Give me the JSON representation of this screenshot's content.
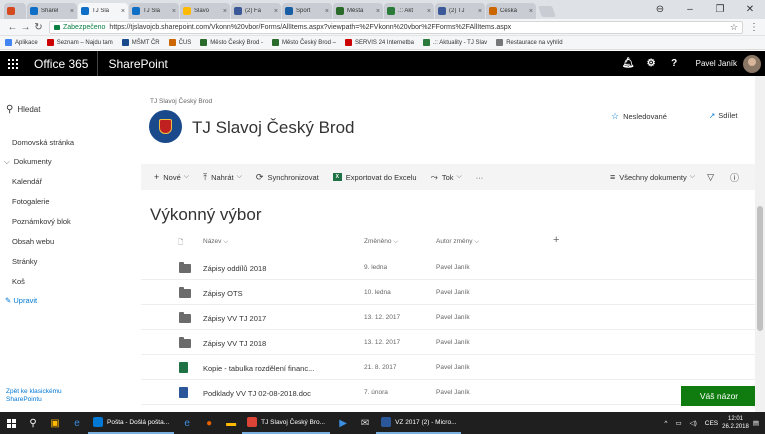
{
  "browser": {
    "tabs": [
      {
        "label": "",
        "color": "#d44a1e",
        "active": false
      },
      {
        "label": "Sharel",
        "color": "#0f6fc6",
        "active": false
      },
      {
        "label": "TJ Sla",
        "color": "#0f6fc6",
        "active": true
      },
      {
        "label": "TJ Sla",
        "color": "#0f6fc6",
        "active": false
      },
      {
        "label": "Slavo",
        "color": "#ffb900",
        "active": false
      },
      {
        "label": "(2) Fa",
        "color": "#3b5998",
        "active": false
      },
      {
        "label": "Sport",
        "color": "#1a5fa6",
        "active": false
      },
      {
        "label": "Města",
        "color": "#2a6a2a",
        "active": false
      },
      {
        "label": ".:: Akt",
        "color": "#2a7a3a",
        "active": false
      },
      {
        "label": "(2) TJ",
        "color": "#3b5998",
        "active": false
      },
      {
        "label": "Česká",
        "color": "#cc6600",
        "active": false
      }
    ],
    "secure_label": "Zabezpečeno",
    "url": "https://tjslavojcb.sharepoint.com/Vkonn%20vbor/Forms/AllItems.aspx?viewpath=%2FVkonn%20vbor%2FForms%2FAllItems.aspx",
    "bookmarks": [
      {
        "label": "Aplikace",
        "color": "#4285f4"
      },
      {
        "label": "Seznam – Najdu tam",
        "color": "#cc0000"
      },
      {
        "label": "MŠMT ČR",
        "color": "#1a4a8c"
      },
      {
        "label": "ČUS",
        "color": "#cc6600"
      },
      {
        "label": "Město Český Brod -",
        "color": "#2a6a2a"
      },
      {
        "label": "Město Český Brod –",
        "color": "#2a6a2a"
      },
      {
        "label": "SERVIS 24 Internetba",
        "color": "#cc0000"
      },
      {
        "label": ".:: Aktuality - TJ Slav",
        "color": "#2a7a3a"
      },
      {
        "label": "Restaurace na vyhlíd",
        "color": "#777777"
      }
    ]
  },
  "suite": {
    "app": "Office 365",
    "product": "SharePoint",
    "user": "Pavel Janík"
  },
  "nav": {
    "search": "Hledat",
    "items": [
      "Domovská stránka",
      "Dokumenty",
      "Kalendář",
      "Fotogalerie",
      "Poznámkový blok",
      "Obsah webu",
      "Stránky",
      "Koš"
    ],
    "edit": "Upravit",
    "back_link": "Zpět ke klasickému SharePointu"
  },
  "site": {
    "breadcrumb": "TJ Slavoj Český Brod",
    "title": "TJ Slavoj Český Brod",
    "follow": "Nesledované",
    "share": "Sdílet"
  },
  "commands": {
    "new": "Nové",
    "upload": "Nahrát",
    "sync": "Synchronizovat",
    "export": "Exportovat do Excelu",
    "flow": "Tok",
    "more": "···",
    "view": "Všechny dokumenty"
  },
  "list": {
    "title": "Výkonný výbor",
    "columns": {
      "name": "Název",
      "modified": "Změněno",
      "modified_by": "Autor změny"
    },
    "rows": [
      {
        "name": "Zápisy oddílů 2018",
        "modified": "9. ledna",
        "by": "Pavel Janík",
        "type": "folder"
      },
      {
        "name": "Zápisy OTS",
        "modified": "10. ledna",
        "by": "Pavel Janík",
        "type": "folder"
      },
      {
        "name": "Zápisy VV TJ 2017",
        "modified": "13. 12. 2017",
        "by": "Pavel Janík",
        "type": "folder"
      },
      {
        "name": "Zápisy VV TJ 2018",
        "modified": "13. 12. 2017",
        "by": "Pavel Janík",
        "type": "folder"
      },
      {
        "name": "Kopie - tabulka rozdělení financ...",
        "modified": "21. 8. 2017",
        "by": "Pavel Janík",
        "type": "xlsx"
      },
      {
        "name": "Podklady VV TJ 02-08-2018.doc",
        "modified": "7. února",
        "by": "Pavel Janík",
        "type": "doc"
      }
    ]
  },
  "feedback": "Váš názor",
  "taskbar": {
    "apps": [
      {
        "label": "Pošta - Došlá pošta...",
        "color": "#0078d4"
      },
      {
        "label": "TJ Slavoj Český Bro...",
        "color": "#db4437"
      },
      {
        "label": "VZ 2017 (2) - Micro...",
        "color": "#2b579a"
      }
    ],
    "lang": "CES",
    "time": "12:01",
    "date": "26.2.2018"
  }
}
